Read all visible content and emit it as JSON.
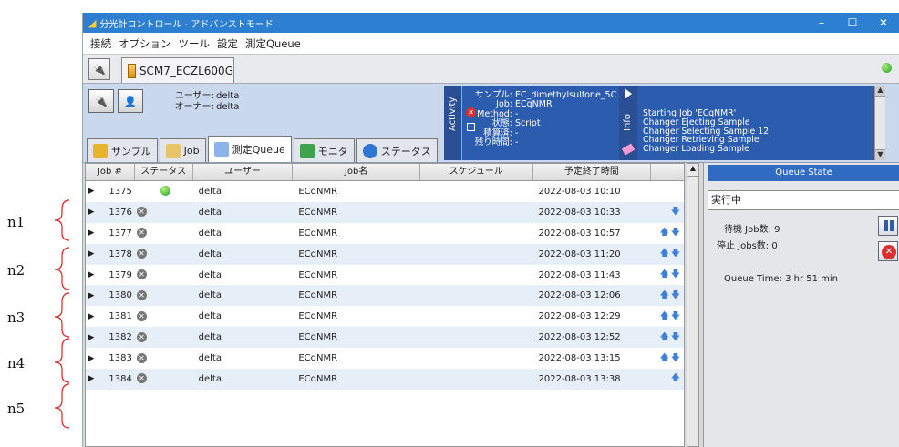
{
  "annotations": [
    "n1",
    "n2",
    "n3",
    "n4",
    "n5"
  ],
  "window": {
    "title": "分光計コントロール - アドバンストモード",
    "controls": [
      "–",
      "☐",
      "✕"
    ]
  },
  "menu": [
    "接続",
    "オプション",
    "ツール",
    "設定",
    "測定Queue"
  ],
  "session": {
    "tab_label": "SCM7_ECZL600G"
  },
  "users": {
    "user_label": "ユーザー:",
    "user_value": "delta",
    "owner_label": "オーナー:",
    "owner_value": "delta"
  },
  "tabs": [
    "サンプル",
    "Job",
    "測定Queue",
    "モニタ",
    "ステータス"
  ],
  "activity": {
    "label": "Activity",
    "rows": [
      {
        "k": "サンプル:",
        "v": "EC_dimethylsulfone_5C"
      },
      {
        "k": "Job:",
        "v": "ECqNMR"
      },
      {
        "k": "Method:",
        "v": "-"
      },
      {
        "k": "状態:",
        "v": "Script"
      },
      {
        "k": "積算済:",
        "v": "-"
      },
      {
        "k": "残り時間:",
        "v": "-"
      }
    ]
  },
  "info": {
    "label": "Info",
    "messages": [
      "Starting Job 'ECqNMR'",
      "Changer Ejecting Sample",
      "Changer Selecting Sample 12",
      "Changer Retrieving Sample",
      "Changer Loading Sample"
    ]
  },
  "table": {
    "headers": [
      "Job #",
      "ステータス",
      "ユーザー",
      "Job名",
      "スケジュール",
      "予定終了時間"
    ],
    "rows": [
      {
        "id": "1375",
        "status": "done",
        "user": "delta",
        "job": "ECqNMR",
        "schedule": "",
        "end": "2022-08-03 10:10",
        "arrows": ""
      },
      {
        "id": "1376",
        "status": "wait",
        "user": "delta",
        "job": "ECqNMR",
        "schedule": "",
        "end": "2022-08-03 10:33",
        "arrows": "down"
      },
      {
        "id": "1377",
        "status": "wait",
        "user": "delta",
        "job": "ECqNMR",
        "schedule": "",
        "end": "2022-08-03 10:57",
        "arrows": "both"
      },
      {
        "id": "1378",
        "status": "wait",
        "user": "delta",
        "job": "ECqNMR",
        "schedule": "",
        "end": "2022-08-03 11:20",
        "arrows": "both"
      },
      {
        "id": "1379",
        "status": "wait",
        "user": "delta",
        "job": "ECqNMR",
        "schedule": "",
        "end": "2022-08-03 11:43",
        "arrows": "both"
      },
      {
        "id": "1380",
        "status": "wait",
        "user": "delta",
        "job": "ECqNMR",
        "schedule": "",
        "end": "2022-08-03 12:06",
        "arrows": "both"
      },
      {
        "id": "1381",
        "status": "wait",
        "user": "delta",
        "job": "ECqNMR",
        "schedule": "",
        "end": "2022-08-03 12:29",
        "arrows": "both"
      },
      {
        "id": "1382",
        "status": "wait",
        "user": "delta",
        "job": "ECqNMR",
        "schedule": "",
        "end": "2022-08-03 12:52",
        "arrows": "both"
      },
      {
        "id": "1383",
        "status": "wait",
        "user": "delta",
        "job": "ECqNMR",
        "schedule": "",
        "end": "2022-08-03 13:15",
        "arrows": "both"
      },
      {
        "id": "1384",
        "status": "wait",
        "user": "delta",
        "job": "ECqNMR",
        "schedule": "",
        "end": "2022-08-03 13:38",
        "arrows": "up"
      }
    ]
  },
  "queue_state": {
    "header": "Queue State",
    "state": "実行中",
    "waiting_label": "待機 Job数:",
    "waiting_value": "9",
    "stopped_label": "停止 Jobs数:",
    "stopped_value": "0",
    "time_label": "Queue Time:",
    "time_value": "3 hr 51 min"
  },
  "colors": {
    "titlebar": "#2d7fd1",
    "panel": "#2b5cae",
    "row_alt": "#e6eef8",
    "accent": "#3d7fd9"
  }
}
